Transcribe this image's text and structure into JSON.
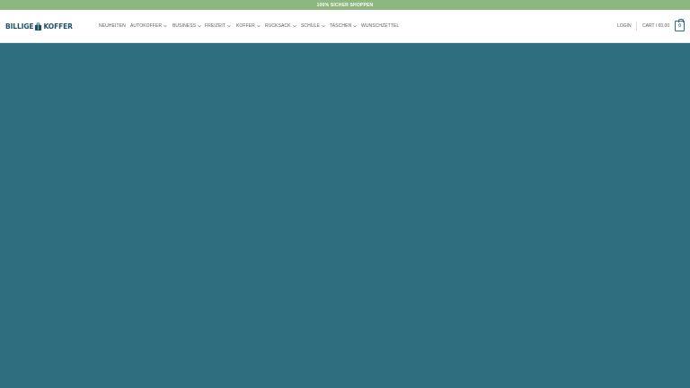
{
  "top_bar": {
    "text": "100% SICHER SHOPPEN"
  },
  "logo": {
    "left": "BILLIGE",
    "right": "KOFFER",
    "icon": "suitcase-icon"
  },
  "nav": [
    {
      "label": "NEUHEITEN",
      "dropdown": false
    },
    {
      "label": "AUTOKOFFER",
      "dropdown": true
    },
    {
      "label": "BUSINESS",
      "dropdown": true
    },
    {
      "label": "FREIZEIT",
      "dropdown": true
    },
    {
      "label": "KOFFER",
      "dropdown": true
    },
    {
      "label": "RUCKSACK",
      "dropdown": true
    },
    {
      "label": "SCHULE",
      "dropdown": true
    },
    {
      "label": "TASCHEN",
      "dropdown": true
    },
    {
      "label": "WUNSCHZETTEL",
      "dropdown": false
    }
  ],
  "account": {
    "login_label": "LOGIN"
  },
  "cart": {
    "label": "CART / €0.00",
    "count": "0"
  },
  "colors": {
    "brand": "#1f4f63",
    "accent": "#2e6e7e",
    "top_bar": "#8cb77f"
  }
}
